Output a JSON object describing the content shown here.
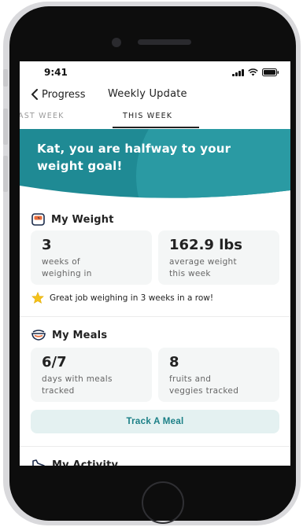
{
  "status_bar": {
    "time": "9:41"
  },
  "nav": {
    "back_label": "Progress",
    "title": "Weekly Update"
  },
  "tabs": [
    {
      "label": "AST WEEK",
      "active": false
    },
    {
      "label": "THIS WEEK",
      "active": true
    }
  ],
  "hero": {
    "message": "Kat, you are halfway to your weight goal!"
  },
  "weight": {
    "title": "My Weight",
    "cards": [
      {
        "value": "3",
        "label_line1": "weeks of",
        "label_line2": "weighing in"
      },
      {
        "value": "162.9 lbs",
        "label_line1": "average weight",
        "label_line2": "this week"
      }
    ],
    "praise": "Great job weighing in 3 weeks in a row!"
  },
  "meals": {
    "title": "My Meals",
    "cards": [
      {
        "value": "6/7",
        "label_line1": "days with meals",
        "label_line2": "tracked"
      },
      {
        "value": "8",
        "label_line1": "fruits and",
        "label_line2": "veggies tracked"
      }
    ],
    "button_label": "Track A Meal"
  },
  "activity": {
    "title": "My Activity"
  },
  "colors": {
    "hero_teal": "#1f8a94",
    "hero_teal_light": "#2a9aa3",
    "accent_teal": "#1a7f86",
    "star": "#f4c21b"
  }
}
